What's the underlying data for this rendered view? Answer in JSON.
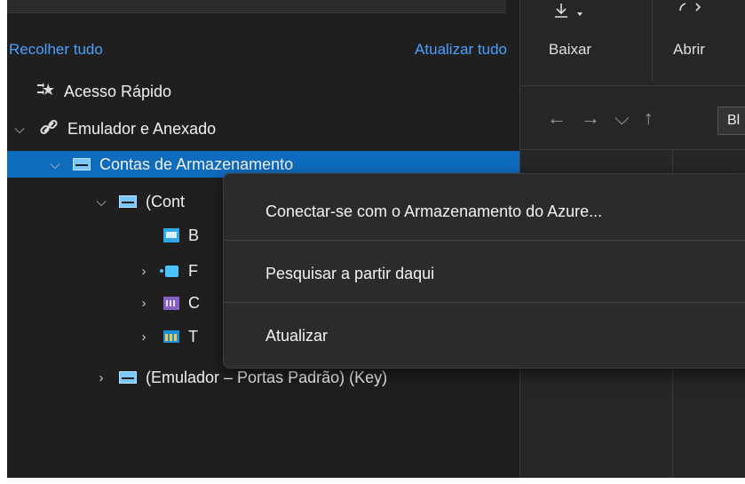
{
  "explorer": {
    "collapse_all": "Recolher tudo",
    "refresh_all": "Atualizar tudo",
    "tree": {
      "quick_access": "Acesso Rápido",
      "emulator_attached": "Emulador e Anexado",
      "storage_accounts": "Contas de Armazenamento",
      "container_node": "(Cont",
      "blob_partial": "B",
      "queue_partial": "F",
      "file_partial": "C",
      "table_partial": "T",
      "emulator_key": "(Emulador – Portas Padrão) (Key)"
    }
  },
  "toolbar": {
    "download": "Baixar",
    "open": "Abrir",
    "path_partial": "Bl"
  },
  "context_menu": {
    "connect": "Conectar-se com o Armazenamento do Azure...",
    "search_from_here": "Pesquisar a partir daqui",
    "refresh": "Atualizar"
  },
  "colors": {
    "selection": "#0f6cbd",
    "link": "#4aa0ff",
    "background": "#1f1f1f"
  }
}
